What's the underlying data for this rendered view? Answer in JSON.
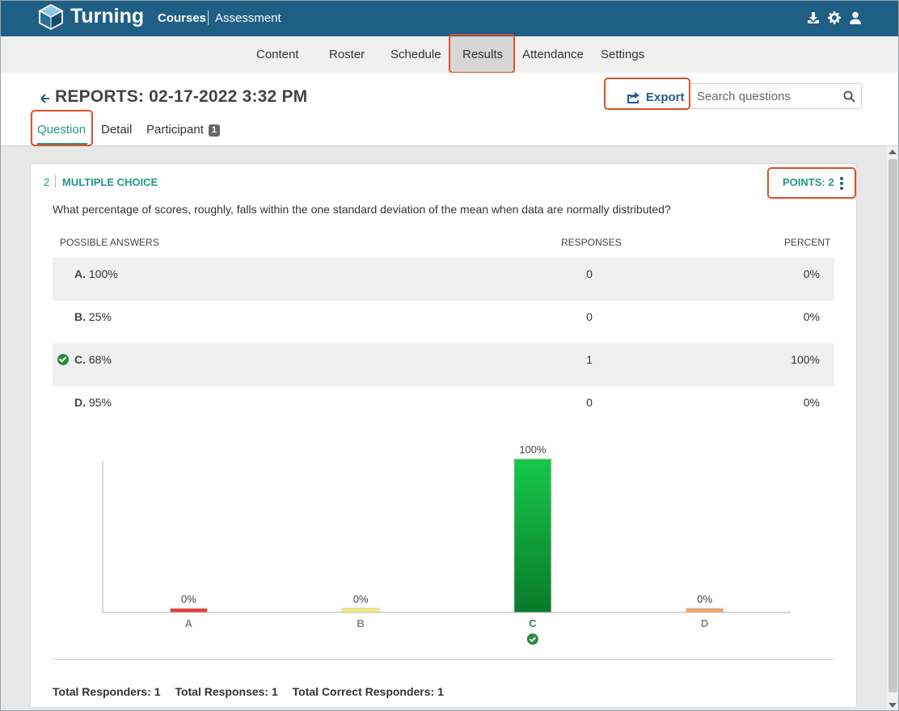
{
  "app": {
    "brand": "Turning",
    "breadcrumb": [
      "Courses",
      "Assessment"
    ]
  },
  "top_icons": [
    "download-icon",
    "gear-icon",
    "user-icon"
  ],
  "nav": {
    "items": [
      "Content",
      "Roster",
      "Schedule",
      "Results",
      "Attendance",
      "Settings"
    ],
    "active": "Results"
  },
  "header": {
    "title": "REPORTS: 02-17-2022 3:32 PM",
    "export_label": "Export",
    "search_placeholder": "Search questions",
    "tabs": [
      "Question",
      "Detail",
      "Participant"
    ],
    "participant_badge": "1",
    "active_tab": "Question"
  },
  "question": {
    "number": "2",
    "type": "MULTIPLE CHOICE",
    "points": "POINTS: 2",
    "text": "What percentage of scores, roughly, falls within the one standard deviation of the mean when data are normally distributed?",
    "headers": {
      "answers": "POSSIBLE ANSWERS",
      "responses": "RESPONSES",
      "percent": "PERCENT"
    },
    "answers": [
      {
        "letter": "A.",
        "text": "100%",
        "responses": "0",
        "percent": "0%",
        "correct": false
      },
      {
        "letter": "B.",
        "text": "25%",
        "responses": "0",
        "percent": "0%",
        "correct": false
      },
      {
        "letter": "C.",
        "text": "68%",
        "responses": "1",
        "percent": "100%",
        "correct": true
      },
      {
        "letter": "D.",
        "text": "95%",
        "responses": "0",
        "percent": "0%",
        "correct": false
      }
    ],
    "totals": {
      "responders": "Total Responders: 1",
      "responses": "Total Responses: 1",
      "correct": "Total Correct Responders: 1"
    }
  },
  "chart_data": {
    "type": "bar",
    "categories": [
      "A",
      "B",
      "C",
      "D"
    ],
    "values": [
      0,
      0,
      100,
      0
    ],
    "value_labels": [
      "0%",
      "0%",
      "100%",
      "0%"
    ],
    "colors": [
      "#e83535",
      "#f5ea6b",
      "#16c84a",
      "#f4a15a"
    ],
    "correct_category": "C",
    "ylim": [
      0,
      100
    ],
    "title": "",
    "xlabel": "",
    "ylabel": "",
    "grid": false
  },
  "colors": {
    "topbar": "#1f5f86",
    "accent": "#1f9a82",
    "highlight": "#e0502a",
    "correct": "#2d8a47"
  }
}
